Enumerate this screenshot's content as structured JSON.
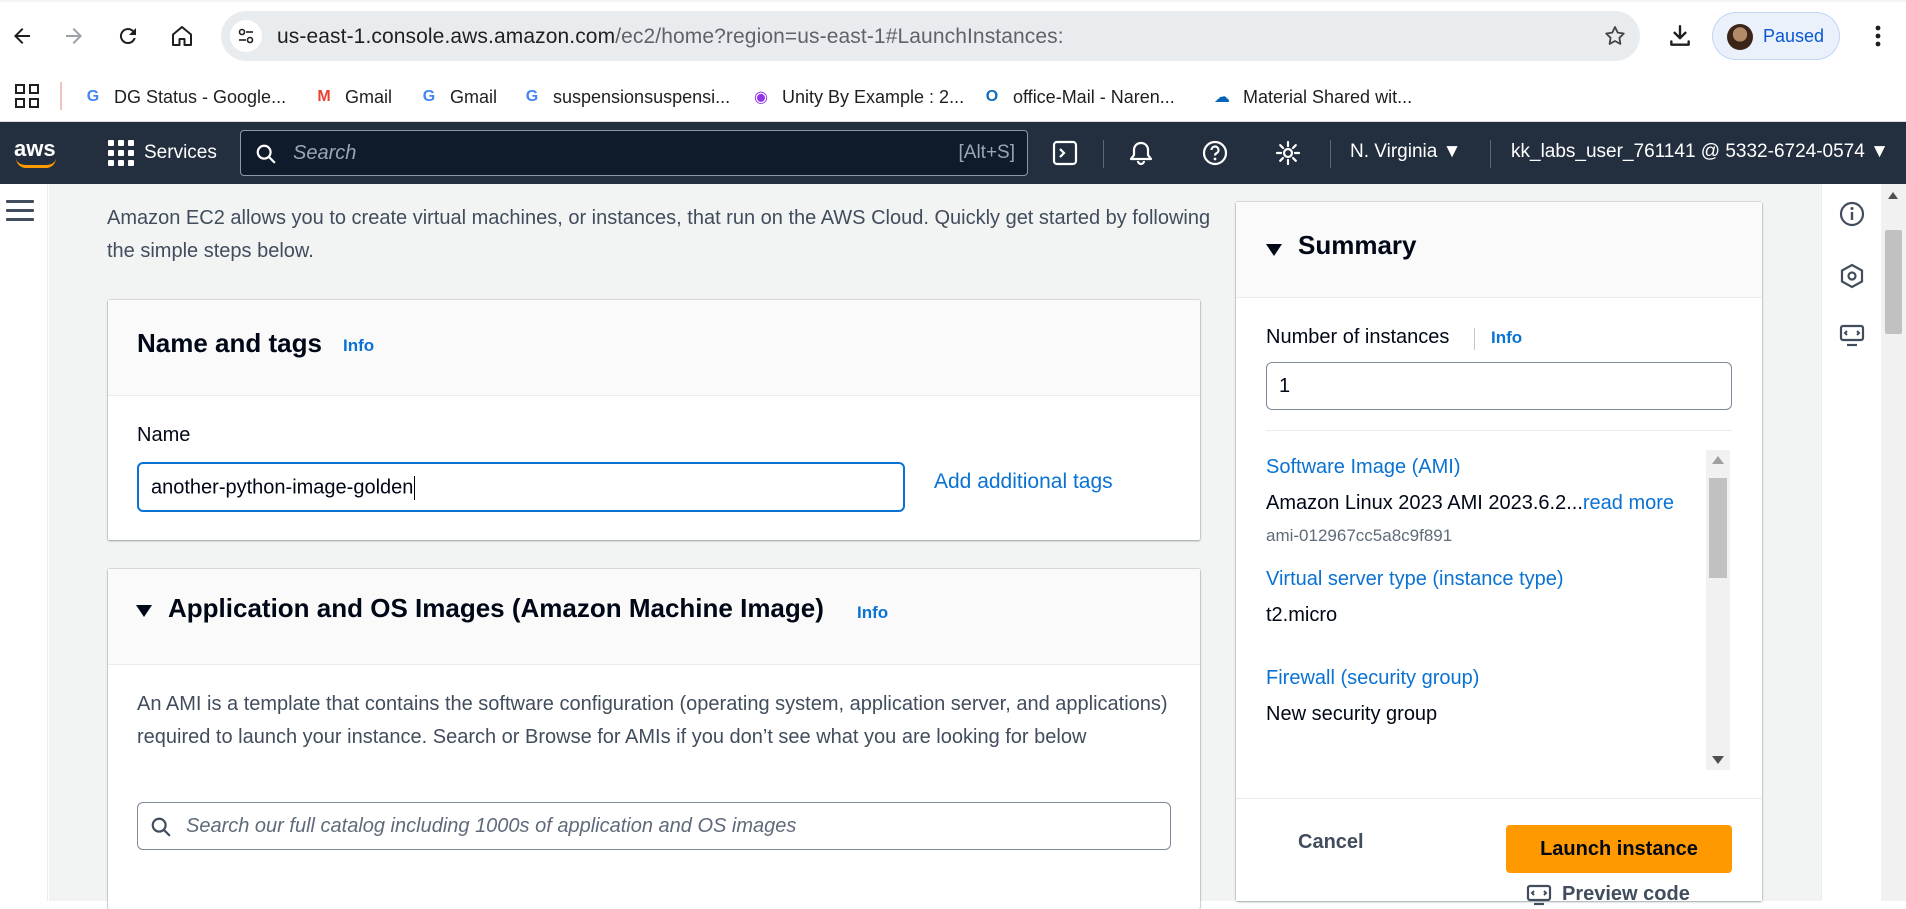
{
  "browser": {
    "url_host": "us-east-1.console.aws.amazon.com",
    "url_path": "/ec2/home?region=us-east-1#LaunchInstances:",
    "profile_status": "Paused",
    "bookmarks": [
      {
        "label": "DG Status - Google...",
        "icon": "google-icon",
        "color": "#4285f4"
      },
      {
        "label": "Gmail",
        "icon": "gmail-icon",
        "color": "#ea4335"
      },
      {
        "label": "Gmail",
        "icon": "google-icon",
        "color": "#4285f4"
      },
      {
        "label": "suspensionsuspensi...",
        "icon": "google-icon",
        "color": "#4285f4"
      },
      {
        "label": "Unity By Example : 2...",
        "icon": "podcast-icon",
        "color": "#9333ea"
      },
      {
        "label": "office-Mail - Naren...",
        "icon": "outlook-icon",
        "color": "#0f6cbd"
      },
      {
        "label": "Material Shared wit...",
        "icon": "onedrive-icon",
        "color": "#0364b8"
      }
    ]
  },
  "aws_header": {
    "logo": "aws",
    "services_label": "Services",
    "search_placeholder": "Search",
    "search_shortcut": "[Alt+S]",
    "region": "N. Virginia",
    "account": "kk_labs_user_761141 @ 5332-6724-0574"
  },
  "intro_text": "Amazon EC2 allows you to create virtual machines, or instances, that run on the AWS Cloud. Quickly get started by following the simple steps below.",
  "name_tags": {
    "title": "Name and tags",
    "info": "Info",
    "name_label": "Name",
    "name_value": "another-python-image-golden",
    "add_tags": "Add additional tags"
  },
  "ami": {
    "title": "Application and OS Images (Amazon Machine Image)",
    "info": "Info",
    "description": "An AMI is a template that contains the software configuration (operating system, application server, and applications) required to launch your instance. Search or Browse for AMIs if you don’t see what you are looking for below",
    "search_placeholder": "Search our full catalog including 1000s of application and OS images"
  },
  "summary": {
    "title": "Summary",
    "instances_label": "Number of instances",
    "instances_info": "Info",
    "instances_value": "1",
    "ami_label": "Software Image (AMI)",
    "ami_value": "Amazon Linux 2023 AMI 2023.6.2...",
    "ami_read_more": "read more",
    "ami_id": "ami-012967cc5a8c9f891",
    "type_label": "Virtual server type (instance type)",
    "type_value": "t2.micro",
    "firewall_label": "Firewall (security group)",
    "firewall_value": "New security group",
    "cancel": "Cancel",
    "launch": "Launch instance",
    "preview": "Preview code"
  },
  "colors": {
    "aws_nav": "#232f3e",
    "launch_orange": "#ff9900",
    "link_blue": "#0972d3"
  }
}
